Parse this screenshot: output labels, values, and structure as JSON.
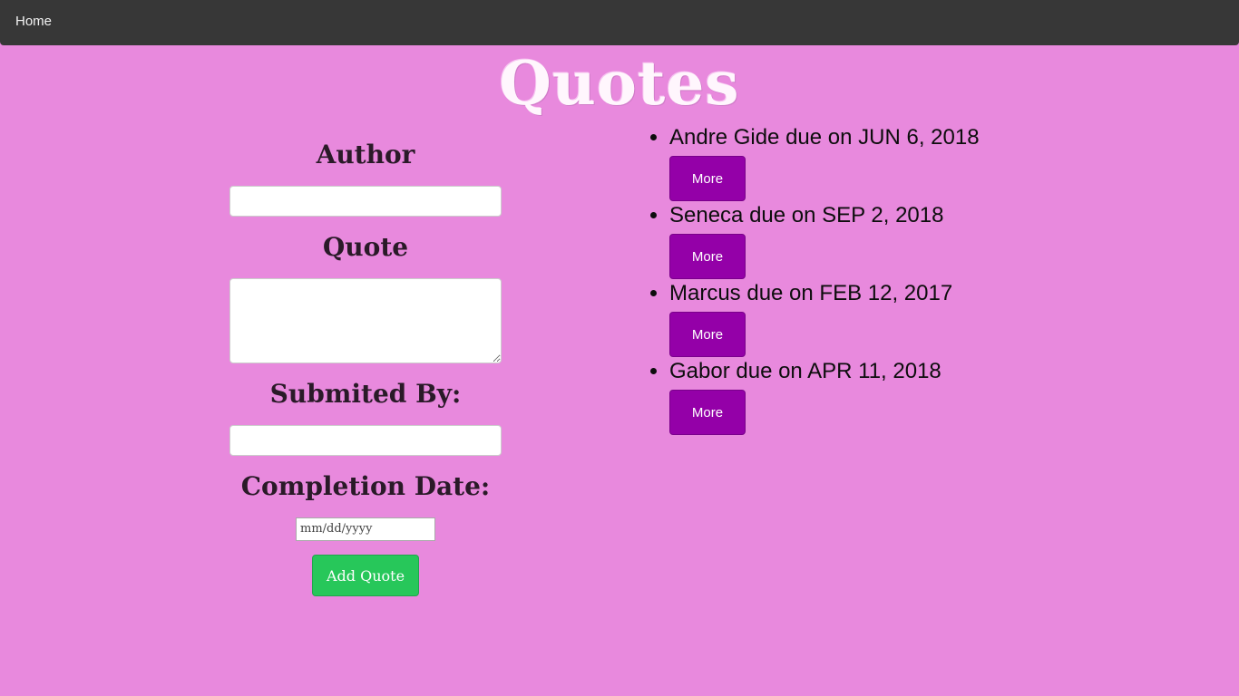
{
  "nav": {
    "home_label": "Home"
  },
  "page": {
    "title": "Quotes"
  },
  "form": {
    "author_label": "Author",
    "author_value": "",
    "quote_label": "Quote",
    "quote_value": "",
    "submitted_by_label": "Submited By:",
    "submitted_by_value": "",
    "completion_date_label": "Completion Date:",
    "completion_date_placeholder": "mm/dd/yyyy",
    "add_button_label": "Add Quote"
  },
  "quotes": [
    {
      "text": "Andre Gide due on JUN 6, 2018",
      "button_label": "More"
    },
    {
      "text": "Seneca due on SEP 2, 2018",
      "button_label": "More"
    },
    {
      "text": "Marcus due on FEB 12, 2017",
      "button_label": "More"
    },
    {
      "text": "Gabor due on APR 11, 2018",
      "button_label": "More"
    }
  ],
  "colors": {
    "background": "#e889dd",
    "navbar": "#373737",
    "more_button": "#9400a8",
    "add_button": "#27c75a"
  }
}
